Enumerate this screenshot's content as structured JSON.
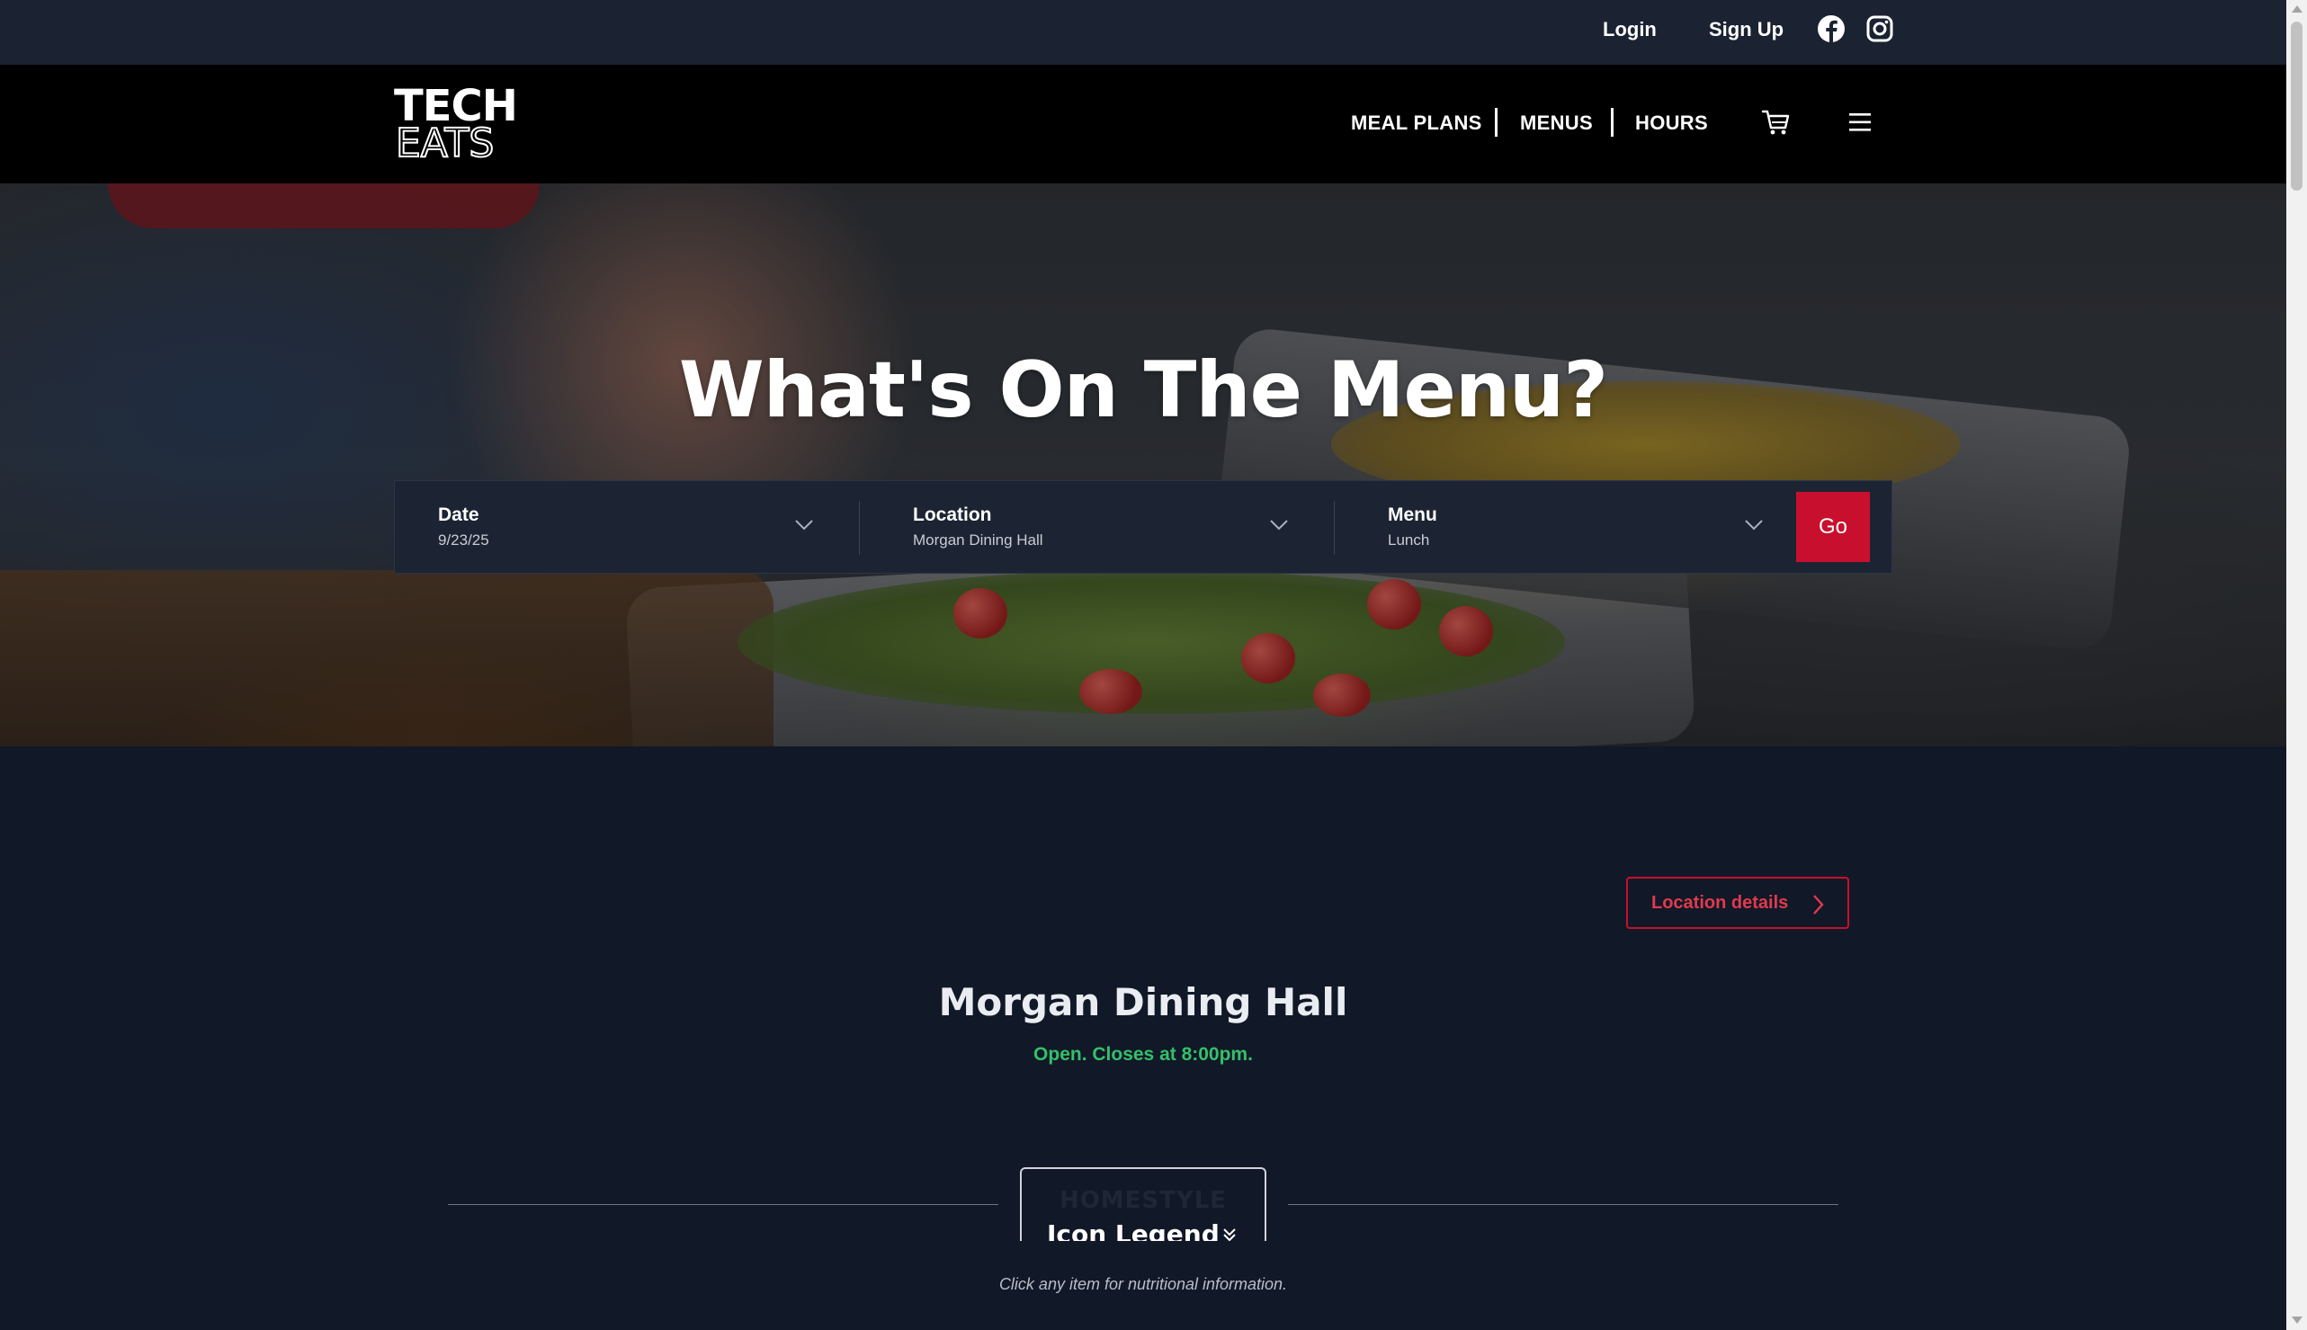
{
  "utility": {
    "login": "Login",
    "signup": "Sign Up",
    "icons": [
      "facebook-icon",
      "instagram-icon"
    ]
  },
  "nav": {
    "logo_line1": "TECH",
    "logo_line2": "EATS",
    "links": [
      "MEAL PLANS",
      "MENUS",
      "HOURS"
    ],
    "icons": [
      "cart-icon",
      "hamburger-menu-icon"
    ]
  },
  "hero": {
    "title": "What's On The Menu?"
  },
  "filters": [
    {
      "label": "Date",
      "value": "9/23/25"
    },
    {
      "label": "Location",
      "value": "Morgan Dining Hall"
    },
    {
      "label": "Menu",
      "value": "Lunch"
    }
  ],
  "go_label": "Go",
  "location_details_label": "Location details",
  "hall": {
    "name": "Morgan Dining Hall",
    "status": "Open. Closes at 8:00pm."
  },
  "legend": {
    "ghost_text": "HOMESTYLE",
    "label": "Icon Legend"
  },
  "hint": "Click any item for nutritional information.",
  "colors": {
    "accent": "#c8102e",
    "status_open": "#34c06a",
    "page_bg": "#111827",
    "nav_bg": "#000000",
    "utility_bg": "#1b2232"
  }
}
